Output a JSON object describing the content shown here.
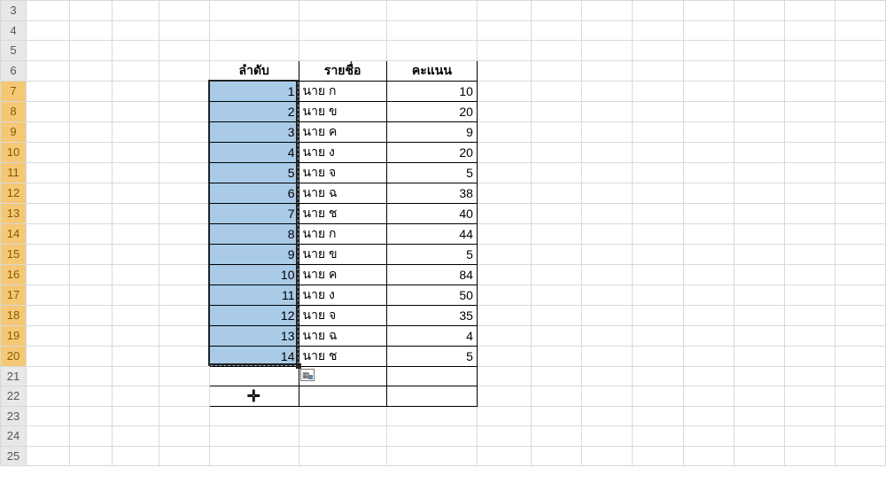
{
  "rows_visible_start": 3,
  "rows_visible_end": 25,
  "header_row": 6,
  "headers": {
    "E": "ลำดับ",
    "F": "รายชื่อ",
    "G": "คะแนน"
  },
  "data_rows": [
    {
      "r": 7,
      "no": 1,
      "name": "นาย ก",
      "score": 10
    },
    {
      "r": 8,
      "no": 2,
      "name": "นาย ข",
      "score": 20
    },
    {
      "r": 9,
      "no": 3,
      "name": "นาย ค",
      "score": 9
    },
    {
      "r": 10,
      "no": 4,
      "name": "นาย ง",
      "score": 20
    },
    {
      "r": 11,
      "no": 5,
      "name": "นาย จ",
      "score": 5
    },
    {
      "r": 12,
      "no": 6,
      "name": "นาย ฉ",
      "score": 38
    },
    {
      "r": 13,
      "no": 7,
      "name": "นาย ช",
      "score": 40
    },
    {
      "r": 14,
      "no": 8,
      "name": "นาย ก",
      "score": 44
    },
    {
      "r": 15,
      "no": 9,
      "name": "นาย ข",
      "score": 5
    },
    {
      "r": 16,
      "no": 10,
      "name": "นาย ค",
      "score": 84
    },
    {
      "r": 17,
      "no": 11,
      "name": "นาย ง",
      "score": 50
    },
    {
      "r": 18,
      "no": 12,
      "name": "นาย จ",
      "score": 35
    },
    {
      "r": 19,
      "no": 13,
      "name": "นาย ฉ",
      "score": 4
    },
    {
      "r": 20,
      "no": 14,
      "name": "นาย ช",
      "score": 5
    }
  ],
  "selected_row_headers": [
    7,
    8,
    9,
    10,
    11,
    12,
    13,
    14,
    15,
    16,
    17,
    18,
    19,
    20
  ],
  "table_row_range": [
    6,
    22
  ],
  "selection": {
    "col": "E",
    "r0": 7,
    "r1": 20
  }
}
